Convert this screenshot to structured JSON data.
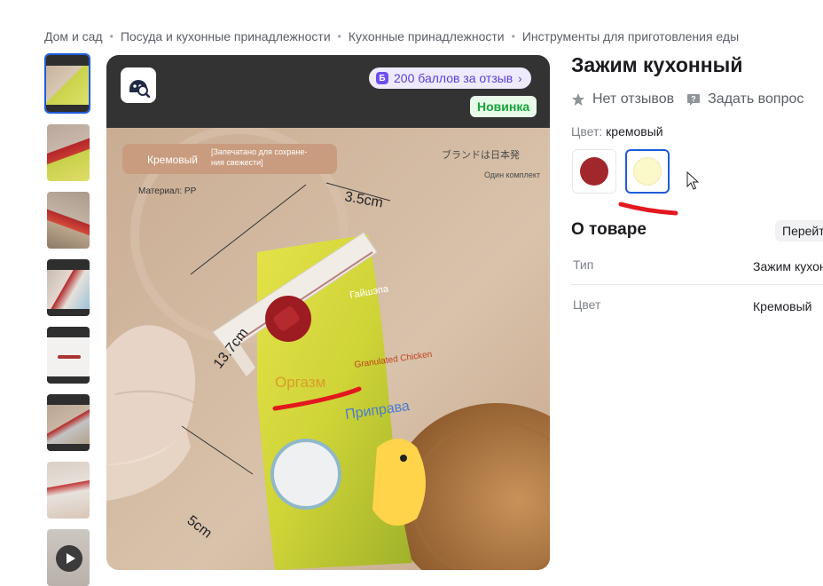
{
  "breadcrumb": {
    "items": [
      "Дом и сад",
      "Посуда и кухонные принадлежности",
      "Кухонные принадлежности",
      "Инструменты для приготовления еды"
    ]
  },
  "gallery": {
    "thumbnail_count": 8,
    "active_index": 0,
    "last_is_video": true
  },
  "main_image": {
    "points_badge": "200 баллов за отзыв",
    "points_icon": "Б",
    "new_badge": "Новинка",
    "photo_texts": {
      "color_tag": "Кремовый",
      "sealed_note": "[Запечатано для сохранения свежести]",
      "brand_note": "ブランドは日本発",
      "set_note": "Один комплект",
      "material": "Материал: PP",
      "dim_width": "3.5cm",
      "dim_length": "13.7cm",
      "dim_depth": "5cm",
      "bag_text_1": "Оргазм",
      "bag_text_2": "Приправа",
      "bag_text_3": "Granulated Chicken",
      "bag_text_4": "Гайшэпа"
    }
  },
  "product": {
    "title": "Зажим кухонный",
    "reviews_label": "Нет отзывов",
    "ask_label": "Задать вопрос",
    "color_label": "Цвет:",
    "color_value": "кремовый",
    "swatches": [
      {
        "name": "red",
        "color": "#a1272d",
        "selected": false
      },
      {
        "name": "cream",
        "color": "#fbf8c9",
        "selected": true
      }
    ]
  },
  "about": {
    "title": "О товаре",
    "goto_label": "Перейти",
    "specs": [
      {
        "key": "Тип",
        "value": "Зажим кухонный"
      },
      {
        "key": "Цвет",
        "value": "Кремовый"
      }
    ]
  },
  "colors": {
    "accent": "#1e5bd8",
    "badge_purple": "#6f4ff2",
    "badge_green": "#18a33a",
    "annotation_red": "#e3181f"
  }
}
